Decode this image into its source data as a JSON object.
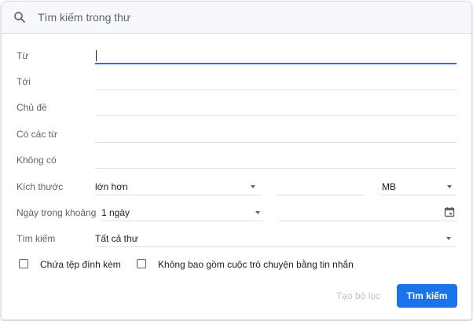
{
  "search": {
    "placeholder": "Tìm kiếm trong thư"
  },
  "fields": {
    "from_label": "Từ",
    "to_label": "Tới",
    "subject_label": "Chủ đề",
    "has_words_label": "Có các từ",
    "doesnt_have_label": "Không có",
    "size_label": "Kích thước",
    "size_operator": "lớn hơn",
    "size_unit": "MB",
    "date_label": "Ngày trong khoảng",
    "date_range": "1 ngày",
    "search_in_label": "Tìm kiếm",
    "search_in_value": "Tất cả thư"
  },
  "checkboxes": {
    "has_attachment": "Chứa tệp đính kèm",
    "exclude_chats": "Không bao gồm cuộc trò chuyện bằng tin nhắn"
  },
  "buttons": {
    "create_filter": "Tạo bộ lọc",
    "search": "Tìm kiếm"
  },
  "colors": {
    "accent": "#1a73e8",
    "label": "#5f6368"
  },
  "icons": [
    "search-icon",
    "calendar-icon",
    "dropdown-caret-icon"
  ]
}
